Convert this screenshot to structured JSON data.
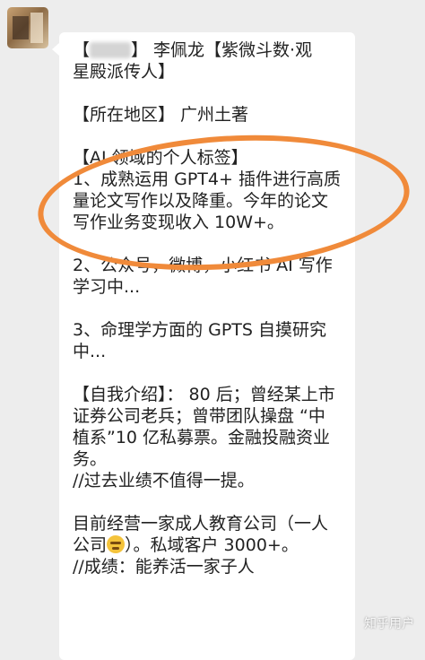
{
  "message": {
    "lines": [
      {
        "before": "【",
        "after": "】 李佩龙【紫微斗数·观",
        "blur": true
      },
      {
        "text": "星殿派传人】"
      },
      {
        "gap": true
      },
      {
        "text": "【所在地区】 广州土著"
      },
      {
        "gap": true
      },
      {
        "text": "【AI 领域的个人标签】"
      },
      {
        "text": "1、成熟运用 GPT4+ 插件进行高质"
      },
      {
        "text": "量论文写作以及降重。今年的论文"
      },
      {
        "text": "写作业务变现收入 10W+。"
      },
      {
        "gap": true
      },
      {
        "text": "2、公众号，微博，小红书 AI 写作"
      },
      {
        "text": "学习中..."
      },
      {
        "gap": true
      },
      {
        "text": "3、命理学方面的 GPTS 自摸研究"
      },
      {
        "text": "中..."
      },
      {
        "gap": true
      },
      {
        "text": "【自我介绍】： 80 后；曾经某上市"
      },
      {
        "text": "证券公司老兵；曾带团队操盘 “中"
      },
      {
        "text": "植系”10 亿私募票。金融投融资业"
      },
      {
        "text": "务。"
      },
      {
        "text": "//过去业绩不值得一提。"
      },
      {
        "gap": true
      },
      {
        "text": "目前经营一家成人教育公司（一人"
      },
      {
        "before": "公司",
        "after": "）。私域客户 3000+。",
        "emoji": true
      },
      {
        "text": "//成绩：能养活一家子人"
      }
    ]
  },
  "watermark": "知乎用户",
  "annotation_color": "#f08a3a"
}
